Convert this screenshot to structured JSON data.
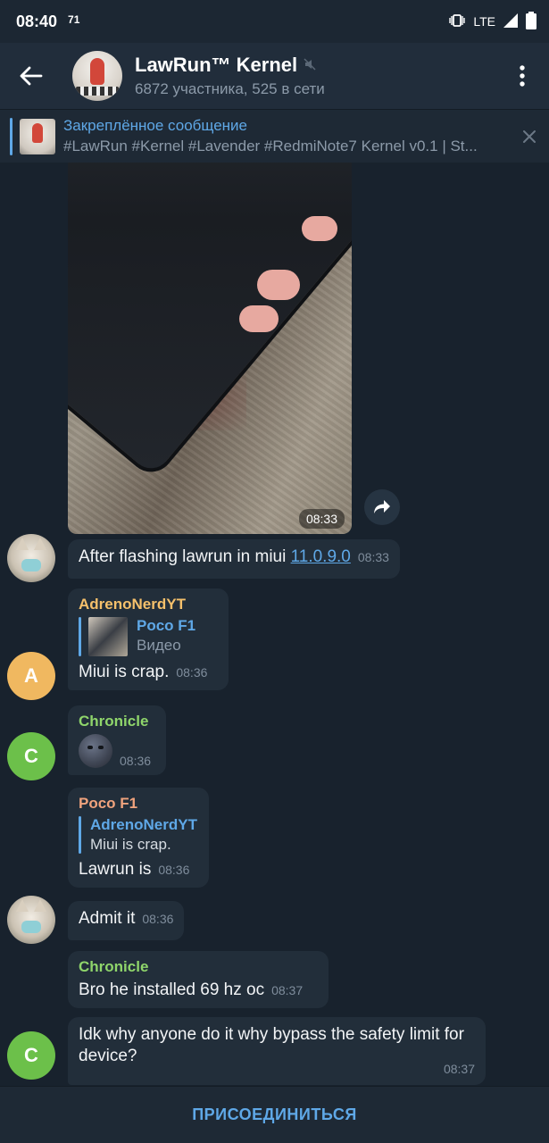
{
  "status": {
    "time": "08:40",
    "notification": "71",
    "network": "LTE"
  },
  "header": {
    "title": "LawRun™ Kernel",
    "subtitle": "6872 участника, 525 в сети",
    "muted_icon": "mute-icon"
  },
  "pinned": {
    "title": "Закреплённое сообщение",
    "body": "#LawRun #Kernel #Lavender #RedmiNote7  Kernel v0.1 | St..."
  },
  "messages": [
    {
      "type": "photo",
      "time": "08:33"
    },
    {
      "text": "After flashing lawrun in miui ",
      "link": "11.0.9.0",
      "time": "08:33"
    },
    {
      "sender": "AdrenoNerdYT",
      "sender_color": "#f5c06b",
      "reply_name": "Poco F1",
      "reply_text": "Видео",
      "text": "Miui is crap.",
      "time": "08:36",
      "avatar_letter": "A",
      "avatar_color": "#f0b860"
    },
    {
      "sender": "Chronicle",
      "sender_color": "#8fd56b",
      "emoji": "new-moon-face",
      "time": "08:36",
      "avatar_letter": "C",
      "avatar_color": "#6cc04a"
    },
    {
      "sender": "Poco F1",
      "sender_color": "#f0a37d",
      "reply_name": "AdrenoNerdYT",
      "reply_text": "Miui is crap.",
      "text": "Lawrun is",
      "time": "08:36"
    },
    {
      "text": "Admit it",
      "time": "08:36"
    },
    {
      "sender": "Chronicle",
      "sender_color": "#8fd56b",
      "text": "Bro he installed 69 hz oc",
      "time": "08:37"
    },
    {
      "text": "Idk why anyone do it why bypass the safety limit for device?",
      "time": "08:37",
      "avatar_letter": "C",
      "avatar_color": "#6cc04a"
    }
  ],
  "bottom": {
    "join_label": "ПРИСОЕДИНИТЬСЯ"
  }
}
